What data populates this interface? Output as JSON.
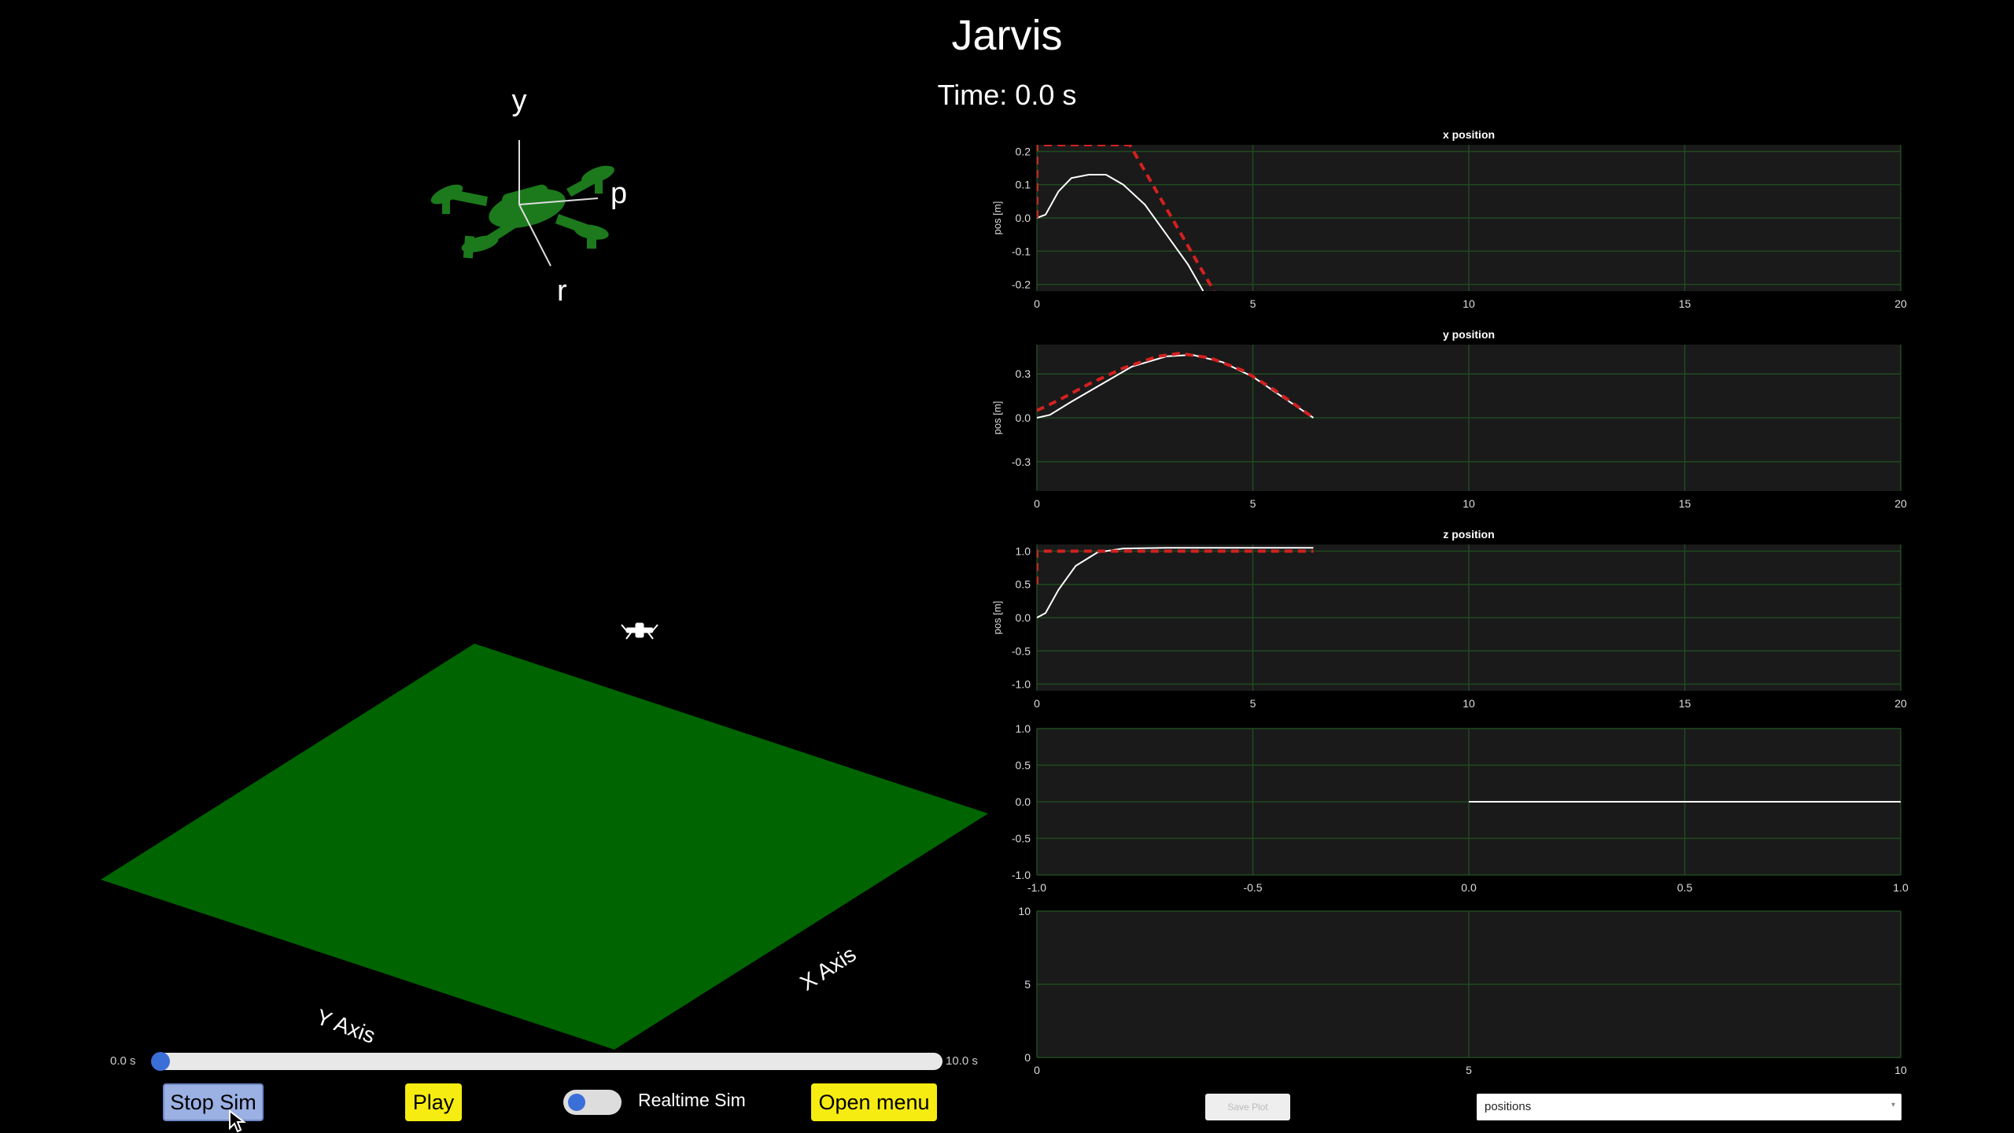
{
  "header": {
    "title": "Jarvis",
    "time": "Time: 0.0 s"
  },
  "drone_view": {
    "labels": {
      "y": "y",
      "p": "p",
      "r": "r"
    },
    "body_color": "#1c7a1c"
  },
  "scene": {
    "ground_color": "#006400",
    "x_axis_label": "X Axis",
    "y_axis_label": "Y Axis"
  },
  "timeline": {
    "min_label": "0.0 s",
    "max_label": "10.0 s",
    "value": 0.0
  },
  "controls": {
    "stop_label": "Stop Sim",
    "play_label": "Play",
    "realtime_label": "Realtime Sim",
    "realtime_on": true,
    "menu_label": "Open menu"
  },
  "plot_controls": {
    "small_button_label": "Save Plot",
    "select_value": "positions"
  },
  "chart_data": [
    {
      "type": "line",
      "title": "x position",
      "ylabel": "pos [m]",
      "xlim": [
        0,
        20
      ],
      "ylim": [
        -0.22,
        0.22
      ],
      "xticks": [
        0,
        5,
        10,
        15,
        20
      ],
      "yticks": [
        -0.2,
        -0.1,
        0.0,
        0.1,
        0.2
      ],
      "ytick_labels": [
        "-0.2",
        "-0.1",
        "0.0",
        "0.1",
        "0.2"
      ],
      "series": [
        {
          "style": "actual",
          "color": "#ffffff",
          "x": [
            0,
            0.2,
            0.5,
            0.8,
            1.2,
            1.6,
            2.0,
            2.5,
            3.0,
            3.5,
            3.85
          ],
          "y": [
            0.0,
            0.01,
            0.08,
            0.12,
            0.13,
            0.13,
            0.1,
            0.04,
            -0.05,
            -0.14,
            -0.22
          ]
        },
        {
          "style": "reference",
          "color": "#d42020",
          "x": [
            0,
            0.0,
            2.15,
            4.1
          ],
          "y": [
            0.0,
            0.22,
            0.22,
            -0.22
          ]
        }
      ]
    },
    {
      "type": "line",
      "title": "y position",
      "ylabel": "pos [m]",
      "xlim": [
        0,
        20
      ],
      "ylim": [
        -0.5,
        0.5
      ],
      "xticks": [
        0,
        5,
        10,
        15,
        20
      ],
      "yticks": [
        -0.3,
        0.0,
        0.3
      ],
      "ytick_labels": [
        "-0.3",
        "0.0",
        "0.3"
      ],
      "series": [
        {
          "style": "actual",
          "color": "#ffffff",
          "x": [
            0,
            0.3,
            0.8,
            1.5,
            2.2,
            3.0,
            3.6,
            4.3,
            5.0,
            5.7,
            6.4
          ],
          "y": [
            0.0,
            0.02,
            0.11,
            0.23,
            0.35,
            0.42,
            0.43,
            0.38,
            0.28,
            0.14,
            0.0
          ]
        },
        {
          "style": "reference",
          "color": "#d42020",
          "x": [
            0,
            0.5,
            1.2,
            2.0,
            2.8,
            3.3,
            4.0,
            4.8,
            5.5,
            6.4
          ],
          "y": [
            0.05,
            0.12,
            0.23,
            0.34,
            0.42,
            0.44,
            0.41,
            0.32,
            0.19,
            0.0
          ]
        }
      ]
    },
    {
      "type": "line",
      "title": "z position",
      "ylabel": "pos [m]",
      "xlim": [
        0,
        20
      ],
      "ylim": [
        -1.1,
        1.1
      ],
      "xticks": [
        0,
        5,
        10,
        15,
        20
      ],
      "yticks": [
        -1.0,
        -0.5,
        0.0,
        0.5,
        1.0
      ],
      "ytick_labels": [
        "-1.0",
        "-0.5",
        "0.0",
        "0.5",
        "1.0"
      ],
      "series": [
        {
          "style": "actual",
          "color": "#ffffff",
          "x": [
            0,
            0.2,
            0.5,
            0.9,
            1.4,
            2.0,
            3.0,
            4.5,
            6.4
          ],
          "y": [
            0.0,
            0.07,
            0.42,
            0.78,
            0.98,
            1.04,
            1.05,
            1.05,
            1.05
          ]
        },
        {
          "style": "reference",
          "color": "#d42020",
          "x": [
            0,
            0.0,
            6.4
          ],
          "y": [
            0.5,
            1.0,
            1.0
          ]
        }
      ]
    },
    {
      "type": "line",
      "title": "",
      "ylabel": "",
      "xlim": [
        -1,
        1
      ],
      "ylim": [
        -1,
        1
      ],
      "xticks": [
        -1.0,
        -0.5,
        0.0,
        0.5,
        1.0
      ],
      "xtick_labels": [
        "-1.0",
        "-0.5",
        "0.0",
        "0.5",
        "1.0"
      ],
      "yticks": [
        -1.0,
        -0.5,
        0.0,
        0.5,
        1.0
      ],
      "ytick_labels": [
        "-1.0",
        "-0.5",
        "0.0",
        "0.5",
        "1.0"
      ],
      "series": [
        {
          "style": "actual",
          "color": "#ffffff",
          "x": [
            0,
            1
          ],
          "y": [
            0,
            0
          ]
        }
      ]
    },
    {
      "type": "line",
      "title": "",
      "ylabel": "",
      "xlim": [
        0,
        10
      ],
      "ylim": [
        0,
        10
      ],
      "xticks": [
        0,
        5,
        10
      ],
      "yticks": [
        0,
        5,
        10
      ],
      "series": []
    }
  ]
}
